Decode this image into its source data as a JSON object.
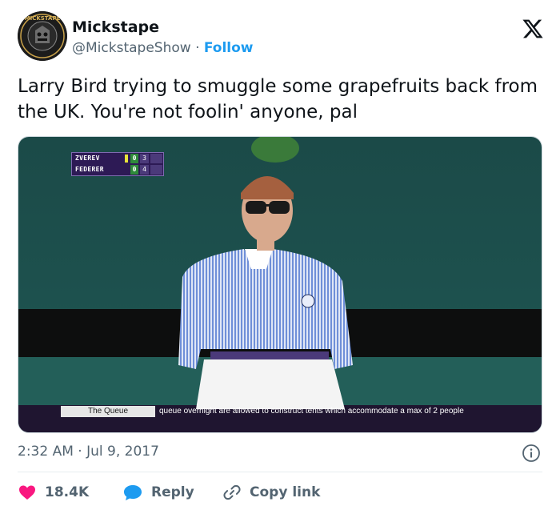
{
  "author": {
    "name": "Mickstape",
    "handle": "@MickstapeShow",
    "separator": "·",
    "follow_label": "Follow",
    "avatar_text": "MICKSTAPE"
  },
  "platform_icon": "x-logo-icon",
  "tweet": {
    "text": "Larry Bird trying to smuggle some grapefruits back from the UK. You're not foolin' anyone, pal"
  },
  "media": {
    "scoreboard": {
      "rows": [
        {
          "name": "ZVEREV",
          "set": "0",
          "game": "3"
        },
        {
          "name": "FEDERER",
          "set": "0",
          "game": "4"
        }
      ]
    },
    "ticker": {
      "label": "The Queue",
      "text": "queue overnight are allowed to construct tents which accommodate a max of 2 people"
    }
  },
  "meta": {
    "timestamp": "2:32 AM · Jul 9, 2017"
  },
  "actions": {
    "like_count": "18.4K",
    "reply_label": "Reply",
    "copy_label": "Copy link"
  },
  "colors": {
    "link": "#1d9bf0",
    "like": "#f91880",
    "secondary_text": "#536471",
    "primary_text": "#0f1419"
  }
}
